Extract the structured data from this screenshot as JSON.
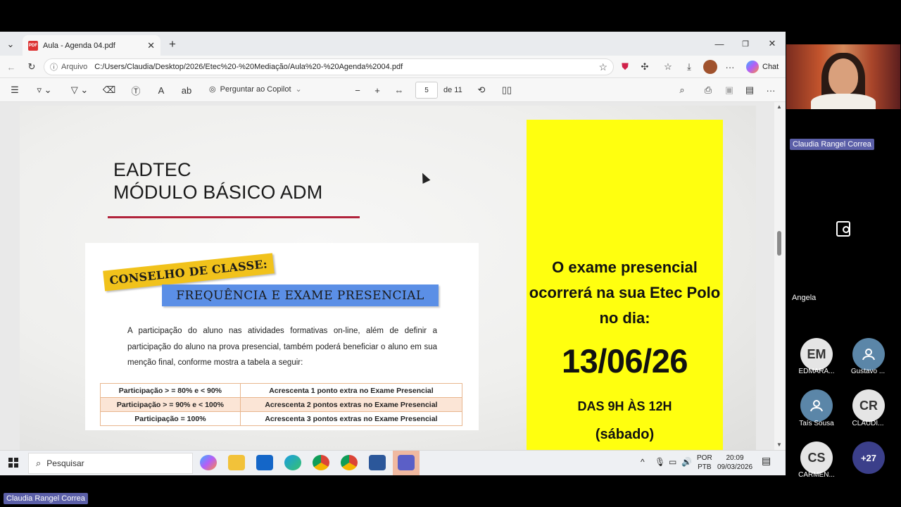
{
  "browser": {
    "tab_title": "Aula - Agenda 04.pdf",
    "address_label": "Arquivo",
    "address_url": "C:/Users/Claudia/Desktop/2026/Etec%20-%20Mediação/Aula%20-%20Agenda%2004.pdf",
    "chat_label": "Chat"
  },
  "pdf_toolbar": {
    "copilot_label": "Perguntar ao Copilot",
    "page_current": "5",
    "page_total": "de 11"
  },
  "slide": {
    "title_line1": "EADTEC",
    "title_line2": "MÓDULO BÁSICO ADM",
    "stamp": "CONSELHO DE CLASSE:",
    "banner": "FREQUÊNCIA E EXAME PRESENCIAL",
    "paragraph": "A participação do aluno nas atividades formativas on-line, além de definir a participação do aluno na prova presencial, também poderá beneficiar o aluno em sua menção final, conforme mostra a tabela a seguir:",
    "table": [
      [
        "Participação > = 80% e < 90%",
        "Acrescenta 1 ponto extra no Exame Presencial"
      ],
      [
        "Participação > = 90% e < 100%",
        "Acrescenta 2 pontos extras no Exame Presencial"
      ],
      [
        "Participação = 100%",
        "Acrescenta 3 pontos extras no Exame Presencial"
      ]
    ],
    "yellow_text": "O exame presencial ocorrerá na sua Etec Polo no dia:",
    "yellow_date": "13/06/26",
    "yellow_hours": "DAS 9H ÀS 12H",
    "yellow_day": "(sábado)"
  },
  "taskbar": {
    "search_placeholder": "Pesquisar",
    "lang1": "POR",
    "lang2": "PTB",
    "time": "20:09",
    "date": "09/03/2026"
  },
  "meeting": {
    "presenter_name": "Claudia Rangel Correa",
    "participant_angela": "Angela",
    "participants": [
      {
        "initials": "EM",
        "name": "EDMARA..."
      },
      {
        "initials": "",
        "name": "Gustavo ..."
      },
      {
        "initials": "",
        "name": "Taís Sousa"
      },
      {
        "initials": "CR",
        "name": "CLAUDI..."
      },
      {
        "initials": "CS",
        "name": "CARMEN..."
      },
      {
        "initials": "+27",
        "name": ""
      }
    ],
    "bottom_name": "Claudia Rangel Correa"
  }
}
